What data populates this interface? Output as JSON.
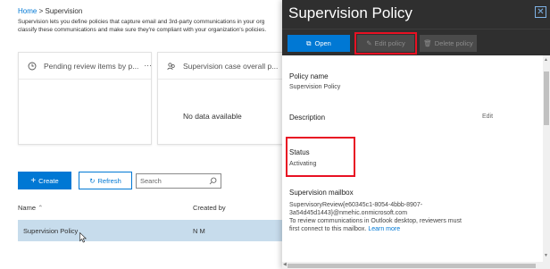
{
  "breadcrumb": {
    "home": "Home",
    "sep": ">",
    "current": "Supervision"
  },
  "intro": {
    "line1": "Supervision lets you define policies that capture email and 3rd-party communications in your org",
    "line2": "classify these communications and make sure they're compliant with your organization's policies."
  },
  "cards": [
    {
      "title": "Pending review items by p...",
      "more": "⋯"
    },
    {
      "title": "Supervision case overall p...",
      "more": "⋯",
      "empty": "No data available"
    }
  ],
  "toolbar": {
    "create_label": "Create",
    "refresh_label": "Refresh",
    "search_placeholder": "Search"
  },
  "table": {
    "columns": [
      "Name",
      "Created by"
    ],
    "rows": [
      {
        "name": "Supervision Policy",
        "created_by": "N M"
      }
    ]
  },
  "panel": {
    "title": "Supervision Policy",
    "open_label": "Open",
    "edit_label": "Edit policy",
    "delete_label": "Delete policy",
    "policy_name_label": "Policy name",
    "policy_name_value": "Supervision Policy",
    "description_label": "Description",
    "edit_link": "Edit",
    "status_label": "Status",
    "status_value": "Activating",
    "mailbox_label": "Supervision mailbox",
    "mailbox_line1": "SupervisoryReview{e60345c1-8054-4bbb-8907-",
    "mailbox_line2": "3a54d45d1443}@nmehic.onmicrosoft.com",
    "mailbox_note1": "To review communications in Outlook desktop, reviewers must",
    "mailbox_note2": "first connect to this mailbox.",
    "learn_more": "Learn more"
  },
  "colors": {
    "accent": "#0078d4",
    "panel_header": "#2f2f2f",
    "highlight": "#e81123",
    "selected_row": "#c7dcec"
  }
}
